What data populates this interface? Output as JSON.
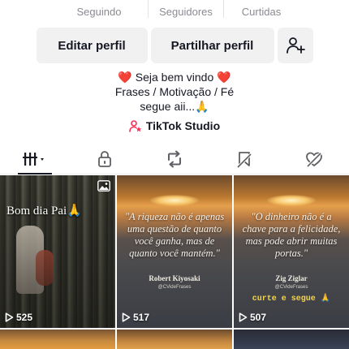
{
  "stats": {
    "following_label": "Seguindo",
    "followers_label": "Seguidores",
    "likes_label": "Curtidas"
  },
  "buttons": {
    "edit_profile": "Editar perfil",
    "share_profile": "Partilhar perfil",
    "add_friend_icon": "add-user-icon"
  },
  "bio": {
    "line1": "❤️ Seja bem vindo ❤️",
    "line2": "Frases / Motivação / Fé",
    "line3": "segue aii...🙏"
  },
  "studio": {
    "label": "TikTok Studio",
    "icon": "studio-icon"
  },
  "tabs": [
    {
      "name": "videos",
      "icon": "grid-icon",
      "active": true
    },
    {
      "name": "private",
      "icon": "lock-icon"
    },
    {
      "name": "reposts",
      "icon": "repost-icon"
    },
    {
      "name": "favorites",
      "icon": "bookmark-icon"
    },
    {
      "name": "liked",
      "icon": "heart-icon"
    }
  ],
  "videos": [
    {
      "title": "Bom dia Pai🙏",
      "views": "525",
      "photo": true
    },
    {
      "quote": "\"A riqueza não é apenas uma questão de quanto você ganha, mas de quanto você mantém.\"",
      "author": "Robert Kiyosaki",
      "handle": "@CVideFrases",
      "views": "517"
    },
    {
      "quote": "\"O dinheiro não é a chave para a felicidade, mas pode abrir muitas portas.\"",
      "author": "Zig Ziglar",
      "handle": "@CVideFrases",
      "cta": "curte e segue 🙏",
      "views": "507"
    }
  ],
  "colors": {
    "accent": "#fe2c55",
    "text": "#161823",
    "muted": "#8a8b91",
    "button_bg": "#f1f1f2"
  }
}
